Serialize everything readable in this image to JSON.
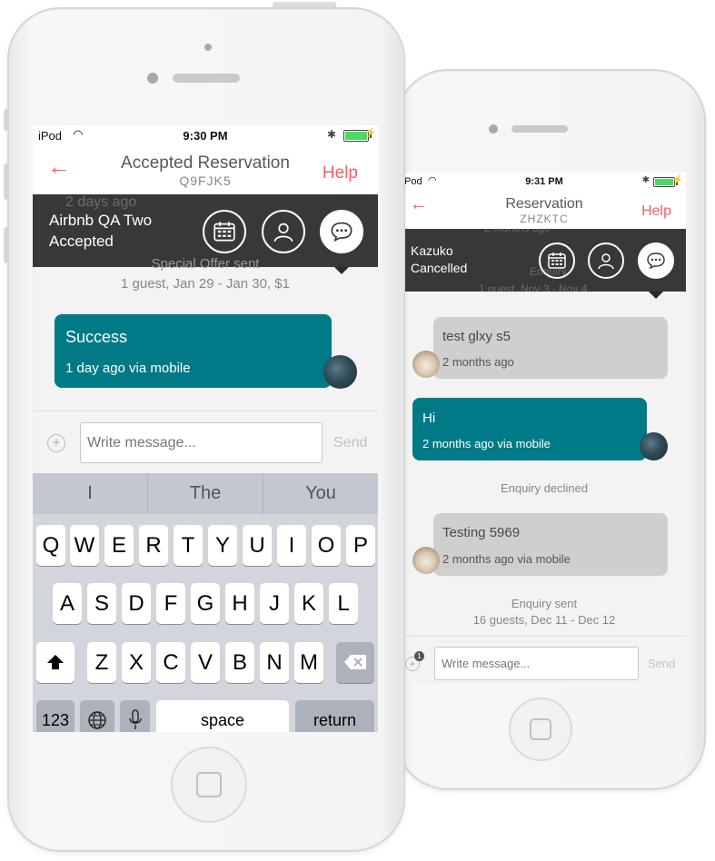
{
  "front": {
    "status": {
      "carrier": "iPod",
      "time": "9:30 PM"
    },
    "nav": {
      "back": "←",
      "title": "Accepted Reservation",
      "code": "Q9FJK5",
      "help": "Help"
    },
    "overlay": {
      "ghost": "2 days ago",
      "name": "Airbnb QA Two",
      "state": "Accepted"
    },
    "system": {
      "line1": "Special Offer sent",
      "line2": "1 guest, Jan 29 - Jan 30, $1"
    },
    "bubble": {
      "text": "Success",
      "meta": "1 day ago via mobile"
    },
    "composer": {
      "placeholder": "Write message...",
      "send": "Send"
    },
    "keyboard": {
      "suggestions": [
        "I",
        "The",
        "You"
      ],
      "row1": [
        "Q",
        "W",
        "E",
        "R",
        "T",
        "Y",
        "U",
        "I",
        "O",
        "P"
      ],
      "row2": [
        "A",
        "S",
        "D",
        "F",
        "G",
        "H",
        "J",
        "K",
        "L"
      ],
      "row3": [
        "Z",
        "X",
        "C",
        "V",
        "B",
        "N",
        "M"
      ],
      "numbers": "123",
      "space": "space",
      "return": "return"
    }
  },
  "back": {
    "status": {
      "carrier": "Pod",
      "time": "9:31 PM"
    },
    "nav": {
      "back": "←",
      "title": "Reservation",
      "code": "ZHZKTC",
      "help": "Help"
    },
    "overlay": {
      "ghost": "2 months ago",
      "name": "Kazuko",
      "state": "Cancelled",
      "ghost2": "Enquiry",
      "ghost3": "1 guest, Nov 3 - Nov 4"
    },
    "messages": {
      "m1": {
        "text": "test glxy s5",
        "meta": "2 months ago"
      },
      "m2": {
        "text": "Hi",
        "meta": "2 months ago via mobile"
      },
      "declined": "Enquiry declined",
      "m3": {
        "text": "Testing 5969",
        "meta": "2 months ago via mobile"
      },
      "sent1": "Enquiry sent",
      "sent2": "16 guests, Dec 11 - Dec 12"
    },
    "composer": {
      "placeholder": "Write message...",
      "send": "Send",
      "badge": "1"
    }
  },
  "colors": {
    "accent": "#ff5a5f",
    "teal": "#007a87",
    "overlay": "#2c2c2c"
  }
}
